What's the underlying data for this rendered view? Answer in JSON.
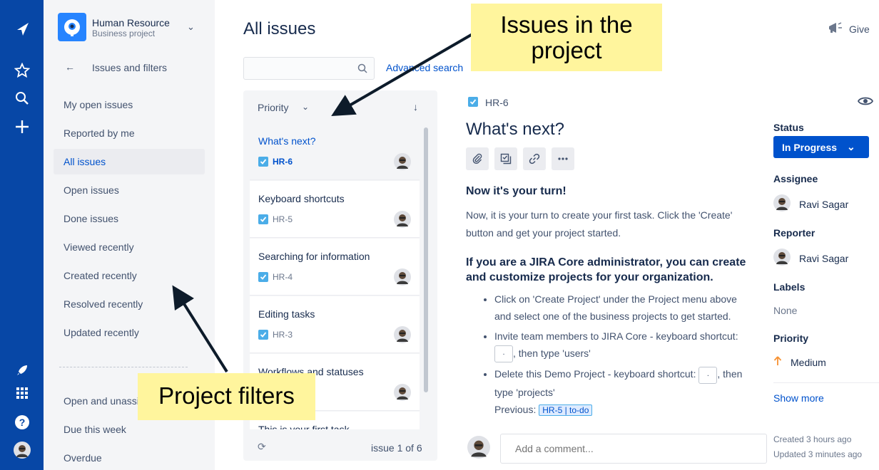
{
  "nav": {
    "icons": [
      "jira-logo-icon",
      "star-icon",
      "search-icon",
      "plus-icon",
      "rocket-icon",
      "app-switcher-icon",
      "help-icon",
      "profile-avatar"
    ]
  },
  "project": {
    "name": "Human Resource",
    "type": "Business project"
  },
  "sidebar": {
    "back_label": "Issues and filters",
    "filters": [
      "My open issues",
      "Reported by me",
      "All issues",
      "Open issues",
      "Done issues",
      "Viewed recently",
      "Created recently",
      "Resolved recently",
      "Updated recently"
    ],
    "active_filter": "All issues",
    "more_filters": [
      "Open and unassigned",
      "Due this week",
      "Overdue"
    ]
  },
  "main": {
    "title": "All issues",
    "search_placeholder": "",
    "advanced_search": "Advanced search",
    "give_feedback": "Give"
  },
  "list": {
    "order_by": "Priority",
    "issues": [
      {
        "title": "What's next?",
        "key": "HR-6"
      },
      {
        "title": "Keyboard shortcuts",
        "key": "HR-5"
      },
      {
        "title": "Searching for information",
        "key": "HR-4"
      },
      {
        "title": "Editing tasks",
        "key": "HR-3"
      },
      {
        "title": "Workflows and statuses",
        "key": ""
      },
      {
        "title": "This is your first task",
        "key": ""
      }
    ],
    "count": "issue 1 of 6"
  },
  "detail": {
    "key": "HR-6",
    "title": "What's next?",
    "heading1": "Now it's your turn!",
    "para1": "Now, it is your turn to create your first task. Click the 'Create' button and get your project started.",
    "heading2": "If you are a JIRA Core administrator, you can create and customize projects for your organization.",
    "bullet1": "Click on 'Create Project' under the Project menu above and select one of the business projects to get started.",
    "bullet2_a": "Invite team members to JIRA Core - keyboard shortcut:",
    "bullet2_b": ", then type 'users'",
    "bullet3_a": "Delete this Demo Project - keyboard shortcut:",
    "bullet3_b": ", then type 'projects'",
    "previous_label": "Previous:",
    "previous_chip": "HR-5 | to-do",
    "comment_placeholder": "Add a comment..."
  },
  "fields": {
    "status_label": "Status",
    "status_value": "In Progress",
    "assignee_label": "Assignee",
    "assignee": "Ravi Sagar",
    "reporter_label": "Reporter",
    "reporter": "Ravi Sagar",
    "labels_label": "Labels",
    "labels_value": "None",
    "priority_label": "Priority",
    "priority_value": "Medium",
    "show_more": "Show more",
    "created": "Created 3 hours ago",
    "updated": "Updated 3 minutes ago"
  },
  "annotations": {
    "issues": "Issues in the project",
    "filters": "Project filters"
  },
  "colors": {
    "nav": "#0747A6",
    "brand": "#0052CC",
    "callout": "#FFF59D",
    "sidebar": "#F4F5F7"
  }
}
